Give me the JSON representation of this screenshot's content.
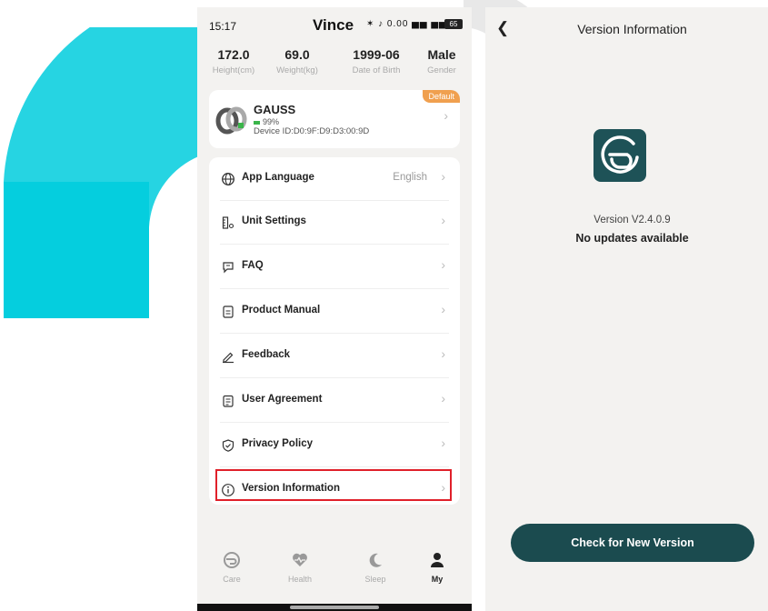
{
  "status_bar": {
    "time": "15:17",
    "name": "Vince",
    "icons": "✶ ♪ 0.00 ▅▅ ▅▅",
    "battery": "65"
  },
  "profile": {
    "stats": [
      {
        "value": "172.0",
        "label": "Height(cm)"
      },
      {
        "value": "69.0",
        "label": "Weight(kg)"
      },
      {
        "value": "1999-06",
        "label": "Date of Birth"
      },
      {
        "value": "Male",
        "label": "Gender"
      }
    ]
  },
  "device": {
    "badge": "Default",
    "name": "GAUSS",
    "battery": "99%",
    "id": "Device ID:D0:9F:D9:D3:00:9D"
  },
  "menu": {
    "items": [
      {
        "label": "App Language",
        "value": "English",
        "icon": "globe-icon"
      },
      {
        "label": "Unit Settings",
        "value": "",
        "icon": "ruler-icon"
      },
      {
        "label": "FAQ",
        "value": "",
        "icon": "faq-icon"
      },
      {
        "label": "Product Manual",
        "value": "",
        "icon": "document-icon"
      },
      {
        "label": "Feedback",
        "value": "",
        "icon": "pen-icon"
      },
      {
        "label": "User Agreement",
        "value": "",
        "icon": "agreement-icon"
      },
      {
        "label": "Privacy Policy",
        "value": "",
        "icon": "shield-icon"
      },
      {
        "label": "Version Information",
        "value": "",
        "icon": "info-icon"
      }
    ]
  },
  "nav": {
    "items": [
      {
        "label": "Care",
        "icon": "care-icon",
        "active": false
      },
      {
        "label": "Health",
        "icon": "heart-icon",
        "active": false
      },
      {
        "label": "Sleep",
        "icon": "moon-icon",
        "active": false
      },
      {
        "label": "My",
        "icon": "person-icon",
        "active": true
      }
    ]
  },
  "version_page": {
    "title": "Version Information",
    "version": "Version V2.4.0.9",
    "status": "No updates available",
    "button": "Check for New Version"
  },
  "colors": {
    "accent": "#1b4b4f",
    "badge": "#f0a04f",
    "highlight": "#e0202a",
    "watermark": "#00ccdd"
  }
}
